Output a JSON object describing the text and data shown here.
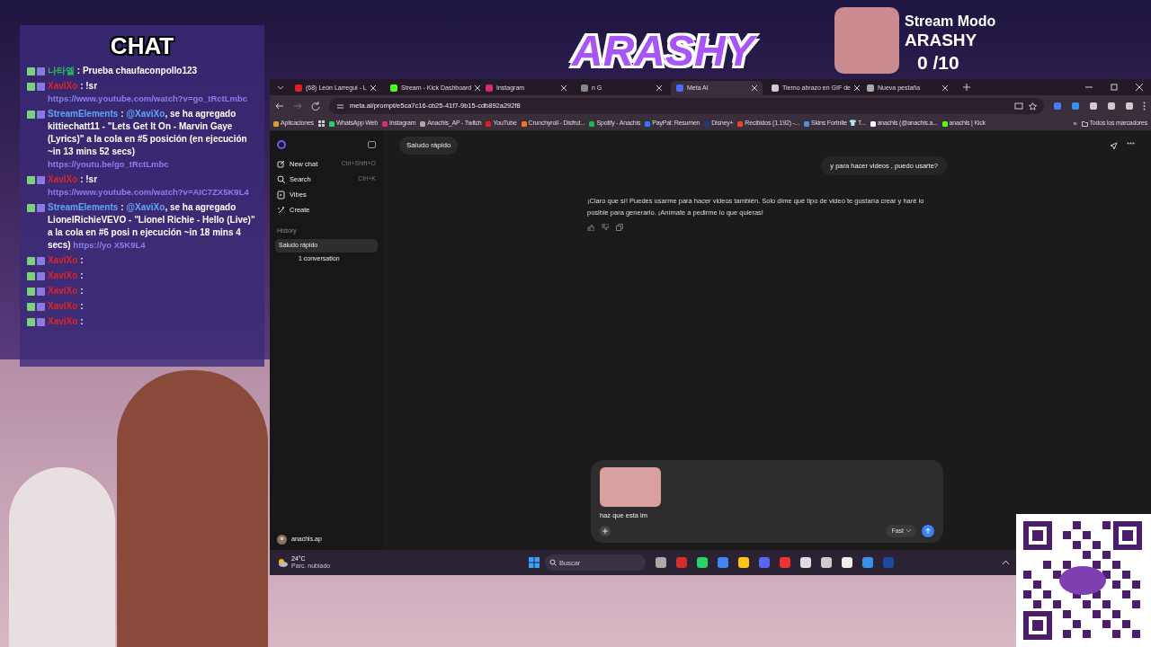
{
  "stream_overlay": {
    "chat_title": "CHAT",
    "logo": "ARASHY",
    "mode_label": "Stream Modo",
    "mode_name": "ARASHY",
    "counter": "0 /10"
  },
  "chat": {
    "messages": [
      {
        "user": "나타엘",
        "color": "#22c55e",
        "separator": ":",
        "text": "Prueba chaufaconpollo123"
      },
      {
        "user": "XaviXo",
        "color": "#dc2626",
        "separator": ":",
        "text": "!sr",
        "link": "https://www.youtube.com/watch?v=go_tRctLmbc"
      },
      {
        "user": "StreamElements",
        "color": "#60a5fa",
        "separator": ":",
        "mention": "@XaviXo",
        "text": ", se ha agregado kittiechatt11 - \"Lets Get It On - Marvin Gaye (Lyrics)\" a la cola en #5 posición (en ejecución ~in 13 mins 52 secs)",
        "link": "https://youtu.be/go_tRctLmbc"
      },
      {
        "user": "XaviXo",
        "color": "#dc2626",
        "separator": ":",
        "text": "!sr",
        "link": "https://www.youtube.com/watch?v=AIC7ZX5K9L4"
      },
      {
        "user": "StreamElements",
        "color": "#60a5fa",
        "separator": ":",
        "mention": "@XaviXo",
        "text": ", se ha agregado LionelRichieVEVO - \"Lionel Richie - Hello (Live)\" a la cola en #6 posi n ejecución ~in 18 mins 4 secs)",
        "link": "https://yo X5K9L4"
      },
      {
        "user": "XaviXo",
        "color": "#dc2626",
        "separator": ":"
      },
      {
        "user": "XaviXo",
        "color": "#dc2626",
        "separator": ":"
      },
      {
        "user": "XaviXo",
        "color": "#dc2626",
        "separator": ":"
      },
      {
        "user": "XaviXo",
        "color": "#dc2626",
        "separator": ":"
      },
      {
        "user": "XaviXo",
        "color": "#dc2626",
        "separator": ":"
      }
    ]
  },
  "browser": {
    "tabs": [
      {
        "label": "(68) León Larregui - L",
        "selected": false
      },
      {
        "label": "Stream - Kick Dashboard",
        "selected": false
      },
      {
        "label": "Instagram",
        "selected": false
      },
      {
        "label": "n G",
        "selected": false
      },
      {
        "label": "Meta AI",
        "selected": true
      },
      {
        "label": "Tierno abrazo en GIF de",
        "selected": false
      },
      {
        "label": "Nueva pestaña",
        "selected": false
      }
    ],
    "url": "meta.ai/prompt/e5ca7c16-cb25-41f7-9b15-cdb892a292f8",
    "bookmarks": [
      "Aplicaciones",
      "WhatsApp Web",
      "Instagram",
      "Anachis_AP - Twitch",
      "YouTube",
      "Crunchyroll - Disfrut...",
      "Spotify - Anachis",
      "PayPal: Resumen",
      "Disney+",
      "Recibidos (1.192) -...",
      "Skins Fortnite 👕 T...",
      "anachis (@anachis.a...",
      "anachis | Kick"
    ],
    "bookmarks_more": "»",
    "all_bookmarks": "Todos los marcadores"
  },
  "meta_ai": {
    "nav": [
      {
        "label": "New chat",
        "shortcut": "Ctrl+Shift+O"
      },
      {
        "label": "Search",
        "shortcut": "Ctrl+K"
      },
      {
        "label": "Vibes"
      },
      {
        "label": "Create"
      }
    ],
    "history_label": "History",
    "history": [
      {
        "label": "Saludo rápido",
        "selected": true
      },
      {
        "label": "1 conversation",
        "selected": false
      }
    ],
    "user": "anachis.ap",
    "title": "Saludo rápido",
    "messages": [
      {
        "kind": "user",
        "text": "y para hacer videos , puedo usarte?"
      },
      {
        "kind": "assistant",
        "text": "¡Claro que sí! Puedes usarme para hacer videos también. Solo dime qué tipo de video te gustaría crear y haré lo posible para generarlo. ¡Anímate a pedirme lo que quieras!"
      }
    ],
    "composer": {
      "value": "haz que esta im",
      "mode": "Fast"
    }
  },
  "taskbar": {
    "temperature": "24°C",
    "weather": "Parc. nublado",
    "search_placeholder": "Buscar"
  }
}
